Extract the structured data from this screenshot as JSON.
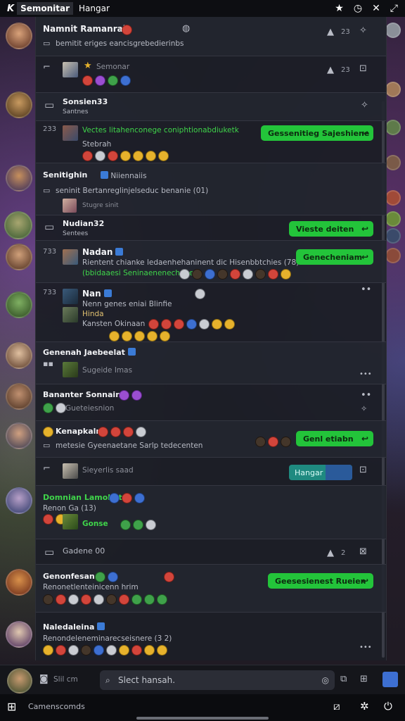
{
  "topbar": {
    "logo": "K",
    "title": "Semonitar",
    "tab": "Hangar"
  },
  "search": {
    "placeholder": "Slect hansah."
  },
  "bottombar": {
    "label": "Slil cm"
  },
  "nav": {
    "label": "Camenscomds"
  },
  "rows": [
    {
      "name": "Namnit Ramanrah",
      "sub": "bemitit eriges eancisgrebedierinbs",
      "count": "23"
    },
    {
      "name": "Semonar",
      "emoji_label": "Semonar",
      "count": "23"
    },
    {
      "name": "Sonsien33",
      "sub": "Santnes"
    },
    {
      "num": "233",
      "text": "Vectes litahenconege coniphtionabdiuketk",
      "sub": "Stebrah",
      "btn": "Gessenitieg Sajeshiene"
    },
    {
      "name": "Senitighin",
      "badge": "Niiennaiis",
      "sub": "seninit Bertanreglinjelseduc benanie (01)",
      "sub2": "Stugre sinit"
    },
    {
      "name": "Nudian32",
      "sub": "Sentees",
      "btn": "Vieste deiten"
    },
    {
      "num": "733",
      "name": "Nadan",
      "sub": "Rientent chianke ledaenhehaninent dic Hisenbbtchies (78)",
      "sub2": "(bbidaaesi Seninaenenecheaen)",
      "btn": "Genecheniam"
    },
    {
      "num": "733",
      "name": "Nan",
      "sub": "Nenn genes eniai Blinfie",
      "sub2": "Hinda",
      "sub3": "Kansten Okinaan"
    },
    {
      "name": "Genenah Jaebeelat",
      "sub": "Sugeide Imas"
    },
    {
      "name": "Bananter Sonnain",
      "sub": "Gueteiesnion"
    },
    {
      "name": "Kenapkaln",
      "sub": "metesie Gyeenaetane Sarlp tedecenten",
      "btn": "Genl etiabn"
    },
    {
      "sub": "Sieyerlis saad",
      "btn": "Hangar"
    },
    {
      "name": "Domnian Lamohat",
      "sub": "Renon Ga (13)",
      "sub2": "Gonse"
    },
    {
      "name": "Gadene 00",
      "count": "2"
    },
    {
      "name": "Genonfesan",
      "sub": "Renonetlenteinicenn hrim",
      "btn": "Geesesienest Rueien"
    },
    {
      "name": "Naledaleina",
      "sub": "Renondeleneminarecseisnere (3 2)"
    }
  ],
  "colors": {
    "accent": "#23c43a",
    "panel": "#1c1e26",
    "teal": "#1f8a80"
  }
}
